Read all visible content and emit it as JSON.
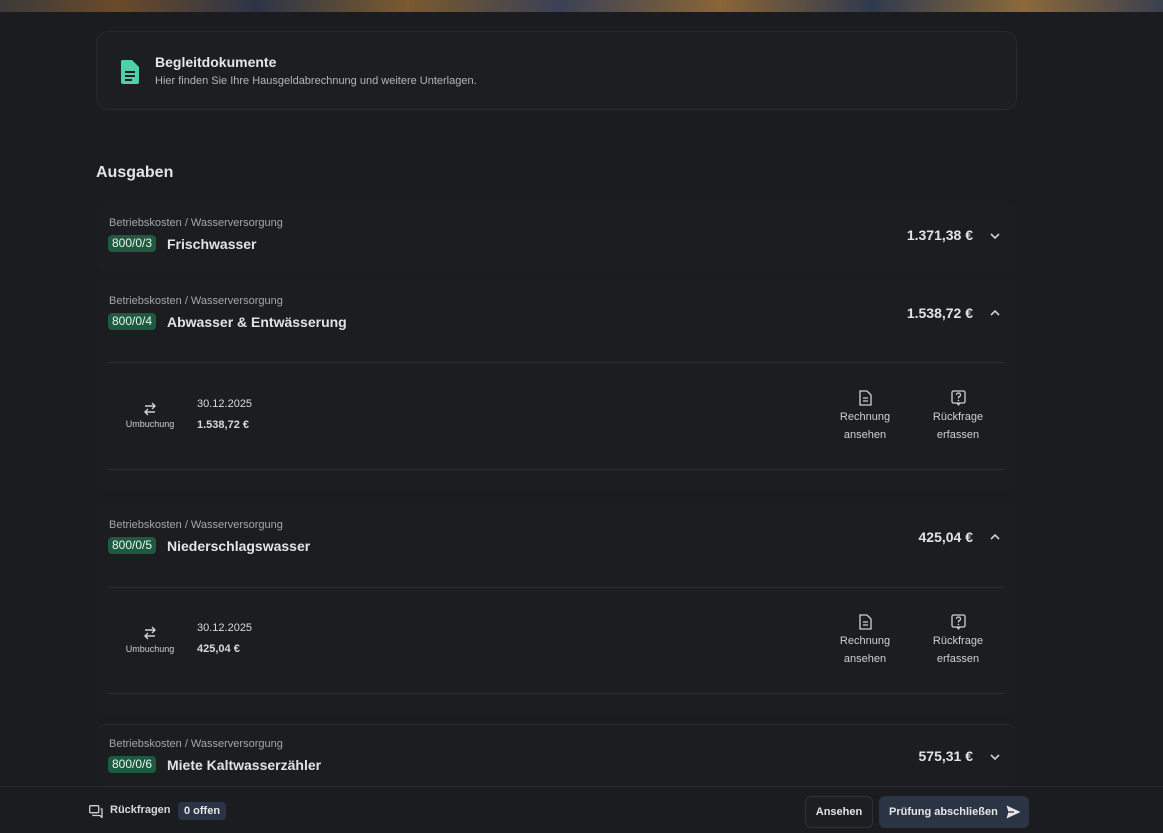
{
  "documents": {
    "title": "Begleitdokumente",
    "subtitle": "Hier finden Sie Ihre Hausgeldabrechnung und weitere Unterlagen."
  },
  "section_title": "Ausgaben",
  "items": [
    {
      "category": "Betriebskosten / Wasserversorgung",
      "code": "800/0/3",
      "name": "Frischwasser",
      "amount": "1.371,38 €",
      "expanded": false
    },
    {
      "category": "Betriebskosten / Wasserversorgung",
      "code": "800/0/4",
      "name": "Abwasser & Entwässerung",
      "amount": "1.538,72 €",
      "expanded": true,
      "transaction": {
        "type": "Umbuchung",
        "date": "30.12.2025",
        "amount": "1.538,72 €",
        "action_invoice_1": "Rechnung",
        "action_invoice_2": "ansehen",
        "action_query_1": "Rückfrage",
        "action_query_2": "erfassen"
      }
    },
    {
      "category": "Betriebskosten / Wasserversorgung",
      "code": "800/0/5",
      "name": "Niederschlagswasser",
      "amount": "425,04 €",
      "expanded": true,
      "transaction": {
        "type": "Umbuchung",
        "date": "30.12.2025",
        "amount": "425,04 €",
        "action_invoice_1": "Rechnung",
        "action_invoice_2": "ansehen",
        "action_query_1": "Rückfrage",
        "action_query_2": "erfassen"
      }
    },
    {
      "category": "Betriebskosten / Wasserversorgung",
      "code": "800/0/6",
      "name": "Miete Kaltwasserzähler",
      "amount": "575,31 €",
      "expanded": false
    }
  ],
  "footer": {
    "queries_label": "Rückfragen",
    "queries_badge": "0 offen",
    "view_button": "Ansehen",
    "finish_button": "Prüfung abschließen"
  },
  "colors": {
    "accent_green": "#4fd1a5",
    "code_badge_bg": "#1e5a3f",
    "primary_button_bg": "#2a3445"
  }
}
